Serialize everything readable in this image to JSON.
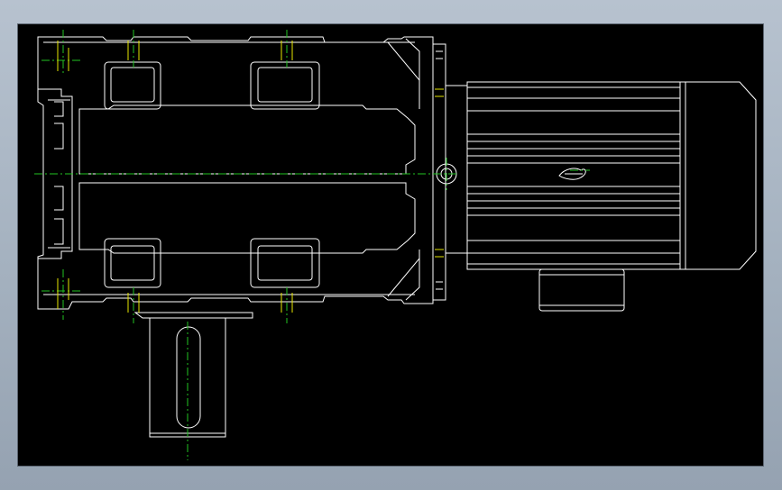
{
  "viewer": {
    "background_color": "#000000",
    "frame_color": "#a4b1bf"
  },
  "drawing": {
    "view": "top",
    "subject": "gear-motor",
    "line_colors": {
      "outline": "#ffffff",
      "centerline": "#22c522",
      "hidden_marker": "#e6e600"
    },
    "components": [
      "gearbox-housing",
      "output-shaft",
      "motor-body",
      "motor-fan-cover",
      "terminal-box",
      "motor-flange",
      "input-coupling"
    ]
  }
}
